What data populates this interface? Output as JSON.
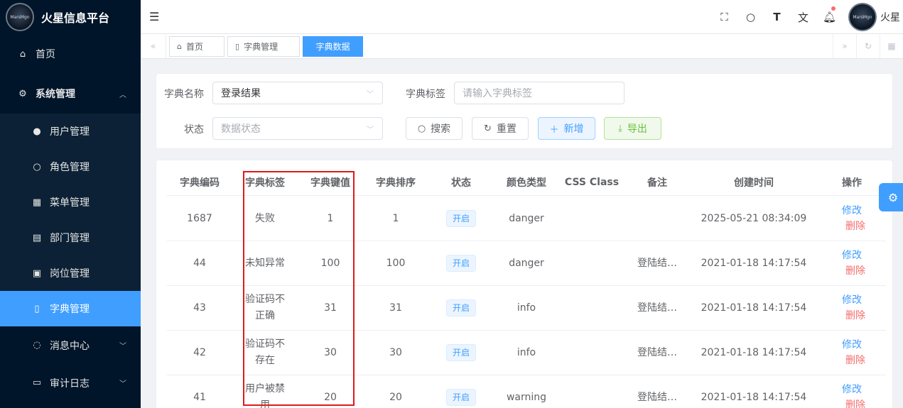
{
  "brand": {
    "title": "火星信息平台",
    "logo_text": "MarsMgn"
  },
  "sidebar": {
    "items": [
      {
        "label": "首页",
        "icon": "home-icon"
      },
      {
        "label": "系统管理",
        "icon": "gear-icon"
      }
    ],
    "system_sub": [
      {
        "label": "用户管理",
        "icon": "user-icon"
      },
      {
        "label": "角色管理",
        "icon": "user-outline-icon"
      },
      {
        "label": "菜单管理",
        "icon": "grid-icon"
      },
      {
        "label": "部门管理",
        "icon": "id-card-icon"
      },
      {
        "label": "岗位管理",
        "icon": "badge-icon"
      },
      {
        "label": "字典管理",
        "icon": "book-icon"
      }
    ],
    "bottom": [
      {
        "label": "消息中心",
        "icon": "chat-icon"
      },
      {
        "label": "审计日志",
        "icon": "log-icon"
      }
    ]
  },
  "header": {
    "username": "火星",
    "avatar_text": "MarsMgn"
  },
  "tags": [
    {
      "label": "首页"
    },
    {
      "label": "字典管理"
    },
    {
      "label": "字典数据"
    }
  ],
  "search": {
    "dict_name_label": "字典名称",
    "dict_name_value": "登录结果",
    "dict_tag_label": "字典标签",
    "dict_tag_placeholder": "请输入字典标签",
    "status_label": "状态",
    "status_placeholder": "数据状态",
    "search_btn": "搜索",
    "reset_btn": "重置",
    "add_btn": "新增",
    "export_btn": "导出"
  },
  "table": {
    "headers": [
      "字典编码",
      "字典标签",
      "字典键值",
      "字典排序",
      "状态",
      "颜色类型",
      "CSS Class",
      "备注",
      "创建时间",
      "操作"
    ],
    "edit_label": "修改",
    "delete_label": "删除",
    "rows": [
      {
        "code": "1687",
        "label": "失败",
        "value": "1",
        "sort": "1",
        "status": "开启",
        "color": "danger",
        "css": "",
        "remark": "",
        "created": "2025-05-21 08:34:09"
      },
      {
        "code": "44",
        "label": "未知异常",
        "value": "100",
        "sort": "100",
        "status": "开启",
        "color": "danger",
        "css": "",
        "remark": "登陆结…",
        "created": "2021-01-18 14:17:54"
      },
      {
        "code": "43",
        "label": "验证码不正确",
        "value": "31",
        "sort": "31",
        "status": "开启",
        "color": "info",
        "css": "",
        "remark": "登陆结…",
        "created": "2021-01-18 14:17:54"
      },
      {
        "code": "42",
        "label": "验证码不存在",
        "value": "30",
        "sort": "30",
        "status": "开启",
        "color": "info",
        "css": "",
        "remark": "登陆结…",
        "created": "2021-01-18 14:17:54"
      },
      {
        "code": "41",
        "label": "用户被禁用",
        "value": "20",
        "sort": "20",
        "status": "开启",
        "color": "warning",
        "css": "",
        "remark": "登陆结…",
        "created": "2021-01-18 14:17:54"
      }
    ]
  }
}
